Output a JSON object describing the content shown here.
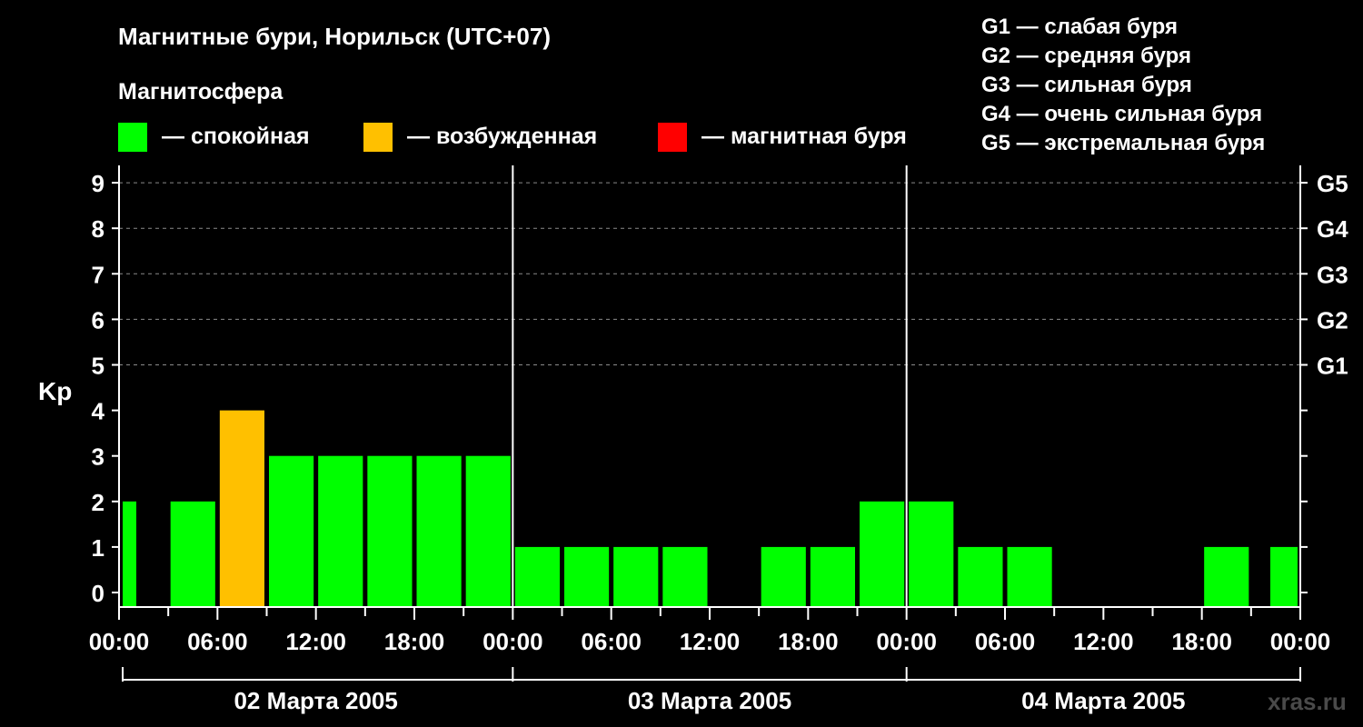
{
  "header": {
    "title": "Магнитные бури, Норильск (UTC+07)",
    "subtitle": "Магнитосфера"
  },
  "legend": [
    {
      "label": "— спокойная",
      "color": "#00ff00"
    },
    {
      "label": "— возбужденная",
      "color": "#ffc000"
    },
    {
      "label": "— магнитная буря",
      "color": "#ff0000"
    }
  ],
  "storm_scale": [
    "G1 — слабая буря",
    "G2 — средняя буря",
    "G3 — сильная буря",
    "G4 — очень сильная буря",
    "G5 — экстремальная буря"
  ],
  "watermark": "xras.ru",
  "colors": {
    "quiet": "#00ff00",
    "active": "#ffc000",
    "storm": "#ff0000",
    "background": "#000000",
    "foreground": "#ffffff"
  },
  "chart_data": {
    "type": "bar",
    "ylabel": "Kp",
    "ylim": [
      0,
      9
    ],
    "y_ticks": [
      "0",
      "1",
      "2",
      "3",
      "4",
      "5",
      "6",
      "7",
      "8",
      "9"
    ],
    "g_ticks": [
      {
        "label": "G1",
        "kp": 5
      },
      {
        "label": "G2",
        "kp": 6
      },
      {
        "label": "G3",
        "kp": 7
      },
      {
        "label": "G4",
        "kp": 8
      },
      {
        "label": "G5",
        "kp": 9
      }
    ],
    "x_tick_labels": [
      "00:00",
      "06:00",
      "12:00",
      "18:00",
      "00:00",
      "06:00",
      "12:00",
      "18:00",
      "00:00",
      "06:00",
      "12:00",
      "18:00",
      "00:00"
    ],
    "days": [
      "02 Марта 2005",
      "03 Марта 2005",
      "04 Марта 2005"
    ],
    "bars": [
      {
        "day": "02 Марта 2005",
        "start": "00:00",
        "end": "03:00",
        "kp": 2,
        "level": "quiet",
        "partial": true
      },
      {
        "day": "02 Марта 2005",
        "start": "03:00",
        "end": "06:00",
        "kp": 2,
        "level": "quiet"
      },
      {
        "day": "02 Марта 2005",
        "start": "06:00",
        "end": "09:00",
        "kp": 4,
        "level": "active"
      },
      {
        "day": "02 Марта 2005",
        "start": "09:00",
        "end": "12:00",
        "kp": 3,
        "level": "quiet"
      },
      {
        "day": "02 Марта 2005",
        "start": "12:00",
        "end": "15:00",
        "kp": 3,
        "level": "quiet"
      },
      {
        "day": "02 Марта 2005",
        "start": "15:00",
        "end": "18:00",
        "kp": 3,
        "level": "quiet"
      },
      {
        "day": "02 Марта 2005",
        "start": "18:00",
        "end": "21:00",
        "kp": 3,
        "level": "quiet"
      },
      {
        "day": "02 Марта 2005",
        "start": "21:00",
        "end": "00:00",
        "kp": 3,
        "level": "quiet"
      },
      {
        "day": "03 Марта 2005",
        "start": "00:00",
        "end": "03:00",
        "kp": 1,
        "level": "quiet"
      },
      {
        "day": "03 Марта 2005",
        "start": "03:00",
        "end": "06:00",
        "kp": 1,
        "level": "quiet"
      },
      {
        "day": "03 Марта 2005",
        "start": "06:00",
        "end": "09:00",
        "kp": 1,
        "level": "quiet"
      },
      {
        "day": "03 Марта 2005",
        "start": "09:00",
        "end": "12:00",
        "kp": 1,
        "level": "quiet"
      },
      {
        "day": "03 Марта 2005",
        "start": "12:00",
        "end": "15:00",
        "kp": 0,
        "level": "quiet"
      },
      {
        "day": "03 Марта 2005",
        "start": "15:00",
        "end": "18:00",
        "kp": 1,
        "level": "quiet"
      },
      {
        "day": "03 Марта 2005",
        "start": "18:00",
        "end": "21:00",
        "kp": 1,
        "level": "quiet"
      },
      {
        "day": "03 Марта 2005",
        "start": "21:00",
        "end": "00:00",
        "kp": 2,
        "level": "quiet"
      },
      {
        "day": "04 Марта 2005",
        "start": "00:00",
        "end": "03:00",
        "kp": 2,
        "level": "quiet"
      },
      {
        "day": "04 Марта 2005",
        "start": "03:00",
        "end": "06:00",
        "kp": 1,
        "level": "quiet"
      },
      {
        "day": "04 Марта 2005",
        "start": "06:00",
        "end": "09:00",
        "kp": 1,
        "level": "quiet"
      },
      {
        "day": "04 Марта 2005",
        "start": "09:00",
        "end": "12:00",
        "kp": 0,
        "level": "quiet"
      },
      {
        "day": "04 Марта 2005",
        "start": "12:00",
        "end": "15:00",
        "kp": 0,
        "level": "quiet"
      },
      {
        "day": "04 Марта 2005",
        "start": "15:00",
        "end": "18:00",
        "kp": 0,
        "level": "quiet"
      },
      {
        "day": "04 Марта 2005",
        "start": "18:00",
        "end": "21:00",
        "kp": 1,
        "level": "quiet"
      },
      {
        "day": "04 Марта 2005",
        "start": "21:00",
        "end": "00:00",
        "kp": 1,
        "level": "quiet",
        "partial": true
      }
    ],
    "grid": "dashed horizontal lines at Kp 5–9",
    "legend_position": "top"
  }
}
